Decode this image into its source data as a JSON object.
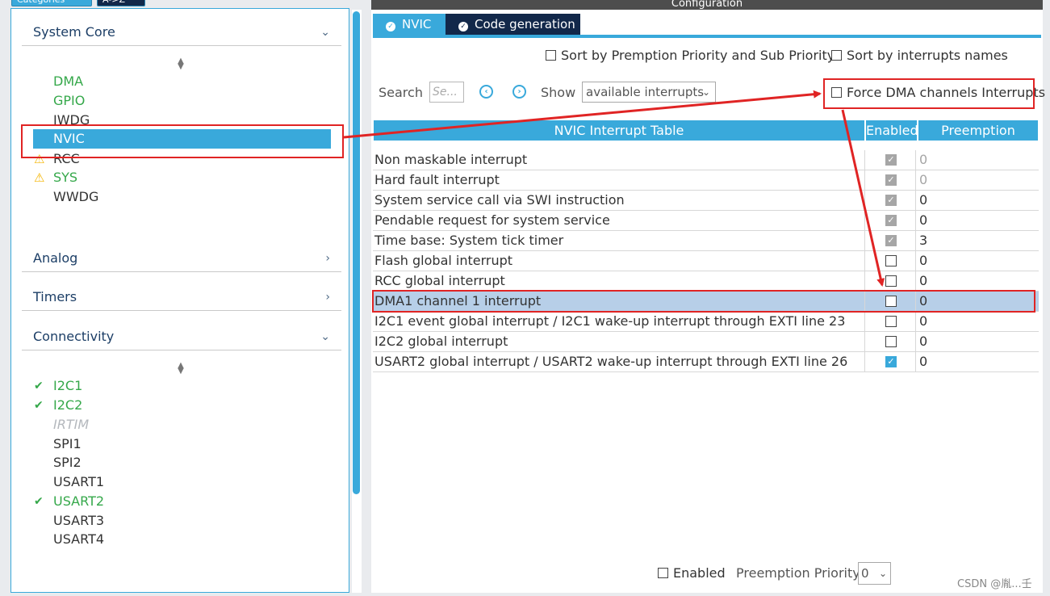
{
  "left": {
    "tabs": {
      "categories": "Categories",
      "az": "A->Z"
    },
    "sections": [
      {
        "label": "System Core",
        "chevron": "⌄"
      },
      {
        "label": "Analog",
        "chevron": "›"
      },
      {
        "label": "Timers",
        "chevron": "›"
      },
      {
        "label": "Connectivity",
        "chevron": "⌄"
      }
    ],
    "system_core_items": [
      {
        "label": "DMA"
      },
      {
        "label": "GPIO"
      },
      {
        "label": "IWDG"
      },
      {
        "label": "NVIC"
      },
      {
        "label": "RCC"
      },
      {
        "label": "SYS"
      },
      {
        "label": "WWDG"
      }
    ],
    "connectivity_items": [
      {
        "label": "I2C1"
      },
      {
        "label": "I2C2"
      },
      {
        "label": "IRTIM"
      },
      {
        "label": "SPI1"
      },
      {
        "label": "SPI2"
      },
      {
        "label": "USART1"
      },
      {
        "label": "USART2"
      },
      {
        "label": "USART3"
      },
      {
        "label": "USART4"
      }
    ]
  },
  "right": {
    "title": "Configuration",
    "tabs": {
      "nvic": "NVIC",
      "codegen": "Code generation"
    },
    "sort_preemption_label": "Sort by Premption Priority and Sub Priority",
    "sort_names_label": "Sort by interrupts names",
    "search_label": "Search",
    "search_placeholder": "Se...",
    "show_label": "Show",
    "show_value": "available interrupts",
    "force_dma_label": "Force DMA channels Interrupts",
    "table": {
      "headers": {
        "name": "NVIC Interrupt Table",
        "enabled": "Enabled",
        "priority": "Preemption Priority"
      },
      "rows": [
        {
          "name": "Non maskable interrupt",
          "enabled": true,
          "locked": true,
          "priority": "0"
        },
        {
          "name": "Hard fault interrupt",
          "enabled": true,
          "locked": true,
          "priority": "0"
        },
        {
          "name": "System service call via SWI instruction",
          "enabled": true,
          "locked": true,
          "priority": "0"
        },
        {
          "name": "Pendable request for system service",
          "enabled": true,
          "locked": true,
          "priority": "0"
        },
        {
          "name": "Time base: System tick timer",
          "enabled": true,
          "locked": true,
          "priority": "3"
        },
        {
          "name": "Flash global interrupt",
          "enabled": false,
          "locked": false,
          "priority": "0"
        },
        {
          "name": "RCC global interrupt",
          "enabled": false,
          "locked": false,
          "priority": "0"
        },
        {
          "name": "DMA1 channel 1 interrupt",
          "enabled": false,
          "locked": false,
          "priority": "0"
        },
        {
          "name": "I2C1 event global interrupt / I2C1 wake-up interrupt through EXTI line 23",
          "enabled": false,
          "locked": false,
          "priority": "0"
        },
        {
          "name": "I2C2 global interrupt",
          "enabled": false,
          "locked": false,
          "priority": "0"
        },
        {
          "name": "USART2 global interrupt / USART2 wake-up interrupt through EXTI line 26",
          "enabled": true,
          "locked": false,
          "priority": "0"
        }
      ]
    },
    "bottom": {
      "enabled_label": "Enabled",
      "priority_label": "Preemption Priority",
      "priority_value": "0"
    },
    "watermark": "CSDN @胤...壬"
  },
  "colors": {
    "accent": "#39a9db",
    "dark_tab": "#12284a",
    "green": "#35a84a",
    "warning": "#f4b400",
    "annotation": "#e02424"
  }
}
